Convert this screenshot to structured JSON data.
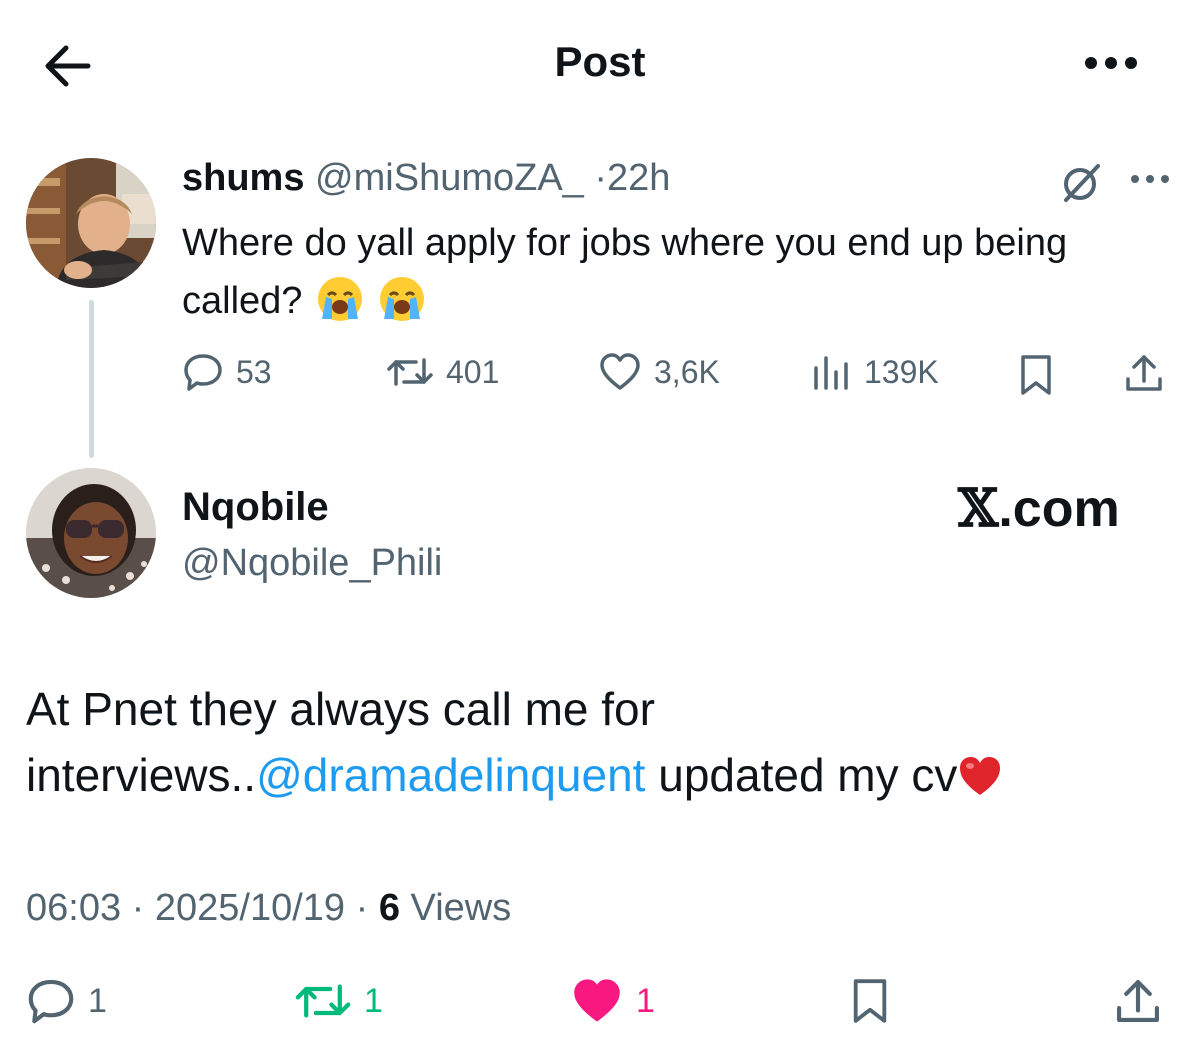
{
  "header": {
    "title": "Post"
  },
  "parent_tweet": {
    "display_name": "shums",
    "handle": "@miShumoZA_",
    "separator": "·",
    "time": "22h",
    "text": "Where do yall apply for jobs where you end up being called?",
    "stats": {
      "replies": "53",
      "reposts": "401",
      "likes": "3,6K",
      "views": "139K"
    }
  },
  "reply_tweet": {
    "display_name": "Nqobile",
    "handle": "@Nqobile_Phili",
    "text_before": "At Pnet they always call me for interviews..",
    "mention": "@dramadelinquent",
    "text_after": " updated my cv",
    "time": "06:03",
    "date": "2025/10/19",
    "separator": "·",
    "views_count": "6",
    "views_label": "Views",
    "stats": {
      "replies": "1",
      "reposts": "1",
      "likes": "1"
    },
    "reposted": true,
    "liked": true
  },
  "watermark": {
    "x_glyph": "𝕏",
    "domain": ".com"
  },
  "colors": {
    "text": "#0f1419",
    "muted": "#536471",
    "link": "#1d9bf0",
    "repost_active": "#00ba7c",
    "like_active": "#f91880",
    "thread_line": "#cfd9de"
  },
  "icons": [
    "back-arrow-icon",
    "more-icon",
    "grok-icon",
    "reply-icon",
    "repost-icon",
    "like-icon",
    "views-icon",
    "bookmark-icon",
    "share-icon",
    "loudly-crying-emoji",
    "red-heart-emoji"
  ]
}
